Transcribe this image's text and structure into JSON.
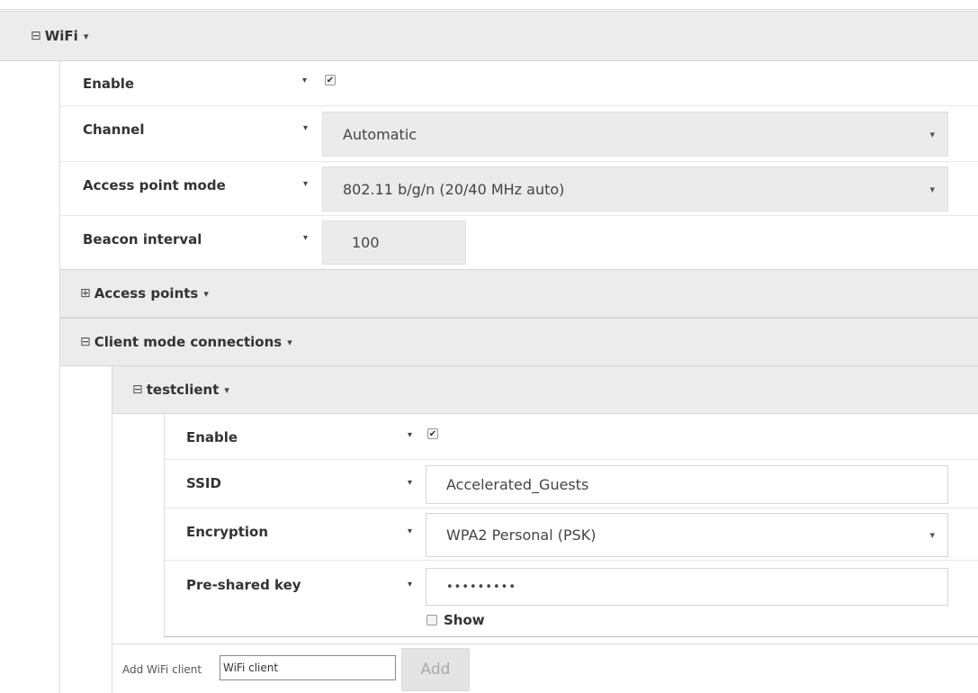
{
  "wifi": {
    "title": "WiFi",
    "fields": {
      "enable": {
        "label": "Enable",
        "checked": true
      },
      "channel": {
        "label": "Channel",
        "value": "Automatic"
      },
      "ap_mode": {
        "label": "Access point mode",
        "value": "802.11 b/g/n (20/40 MHz auto)"
      },
      "beacon": {
        "label": "Beacon interval",
        "value": "100"
      }
    },
    "access_points": {
      "title": "Access points",
      "collapsed": true
    },
    "client_mode": {
      "title": "Client mode connections",
      "client": {
        "title": "testclient",
        "enable": {
          "label": "Enable",
          "checked": true
        },
        "ssid": {
          "label": "SSID",
          "value": "Accelerated_Guests"
        },
        "encryption": {
          "label": "Encryption",
          "value": "WPA2 Personal (PSK)"
        },
        "psk": {
          "label": "Pre-shared key",
          "value": "•••••••••",
          "show_label": "Show"
        }
      },
      "add": {
        "label": "Add WiFi client",
        "input_value": "WiFi client",
        "button_label": "Add"
      }
    }
  },
  "icons": {
    "expanded": "⊟",
    "collapsed": "⊞",
    "caret": "▾",
    "check": "✔"
  }
}
